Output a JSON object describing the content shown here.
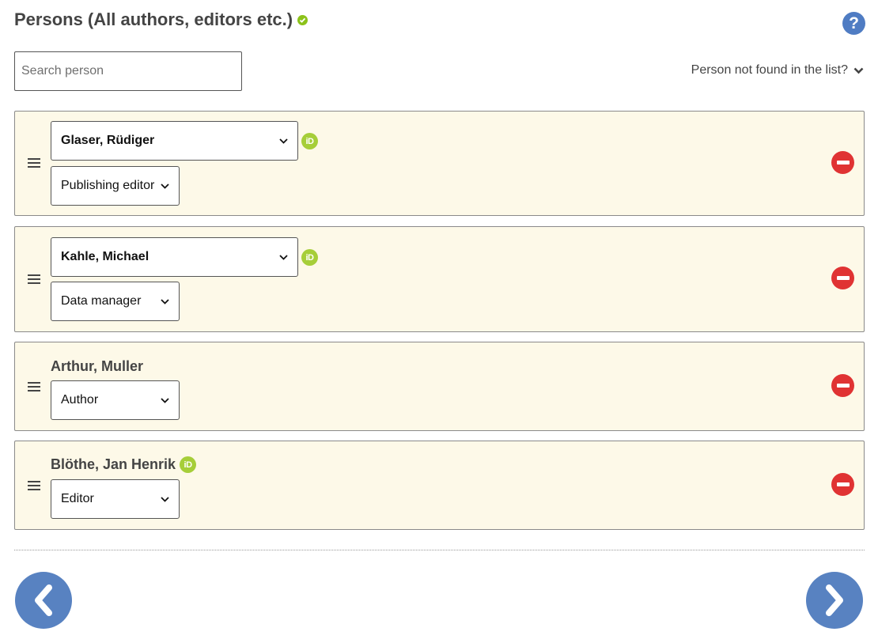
{
  "header": {
    "title": "Persons (All authors, editors etc.)",
    "status_icon": "check-circle-icon",
    "help_icon": "question-circle-icon",
    "help_label": "?"
  },
  "search": {
    "placeholder": "Search person",
    "value": ""
  },
  "not_found": {
    "label": "Person not found in the list?",
    "icon": "chevron-down-icon"
  },
  "persons": [
    {
      "name": "Glaser, Rüdiger",
      "role": "Publishing editor",
      "name_editable": true,
      "orcid": true
    },
    {
      "name": "Kahle, Michael",
      "role": "Data manager",
      "name_editable": true,
      "orcid": true
    },
    {
      "name": "Arthur, Muller",
      "role": "Author",
      "name_editable": false,
      "orcid": false
    },
    {
      "name": "Blöthe, Jan Henrik",
      "role": "Editor",
      "name_editable": false,
      "orcid": true
    }
  ],
  "orcid_label": "iD",
  "navigation": {
    "prev_icon": "chevron-left-icon",
    "next_icon": "chevron-right-icon"
  },
  "colors": {
    "card_background": "#fdf9e8",
    "orcid": "#a6ce39",
    "remove": "#e03333",
    "accent": "#5882c1",
    "success": "#8cc21a"
  }
}
